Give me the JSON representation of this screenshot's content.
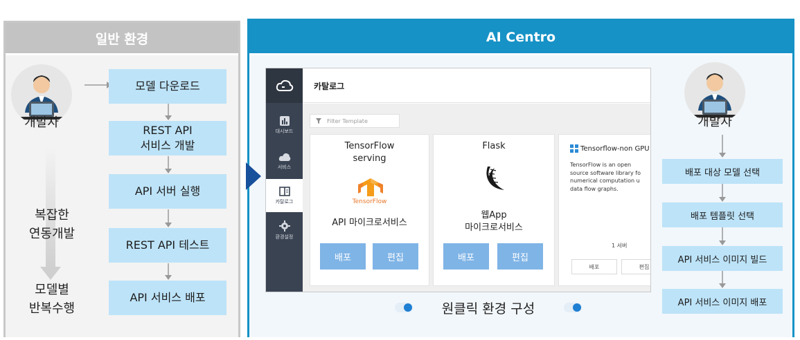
{
  "left": {
    "title": "일반 환경",
    "developer": "개발자",
    "side_top": "복잡한\n연동개발",
    "side_bottom": "모델별\n반복수행",
    "steps": [
      "모델 다운로드",
      "REST API\n서비스 개발",
      "API 서버 실행",
      "REST API 테스트",
      "API 서비스 배포"
    ]
  },
  "right": {
    "title": "AI Centro",
    "developer": "개발자",
    "one_click": "원클릭 환경 구성",
    "flow": [
      "배포 대상 모델 선택",
      "배포 템플릿 선택",
      "API 서비스 이미지 빌드",
      "API 서비스 이미지 배포"
    ]
  },
  "app": {
    "page_title": "카탈로그",
    "sidebar": [
      "대시보드",
      "서비스",
      "카탈로그",
      "환경설정"
    ],
    "filter_placeholder": "Filter Template",
    "cards": [
      {
        "title": "TensorFlow\nserving",
        "logo_text": "TensorFlow",
        "desc": "API 마이크로서비스",
        "btn_deploy": "배포",
        "btn_edit": "편집"
      },
      {
        "title": "Flask",
        "desc": "웹App\n마이크로서비스",
        "btn_deploy": "배포",
        "btn_edit": "편집"
      },
      {
        "title": "Tensorflow-non GPU",
        "desc": "TensorFlow is an open\nsource software library fo\nnumerical computation u\ndata flow graphs.",
        "count": "1 서버",
        "btn_deploy": "배포",
        "btn_edit": "편집"
      }
    ]
  },
  "colors": {
    "accent": "#1692c6",
    "box": "#bde3f8",
    "button": "#7fb4e6",
    "sidebar": "#3a4352",
    "gray_header": "#c3c3c3"
  }
}
